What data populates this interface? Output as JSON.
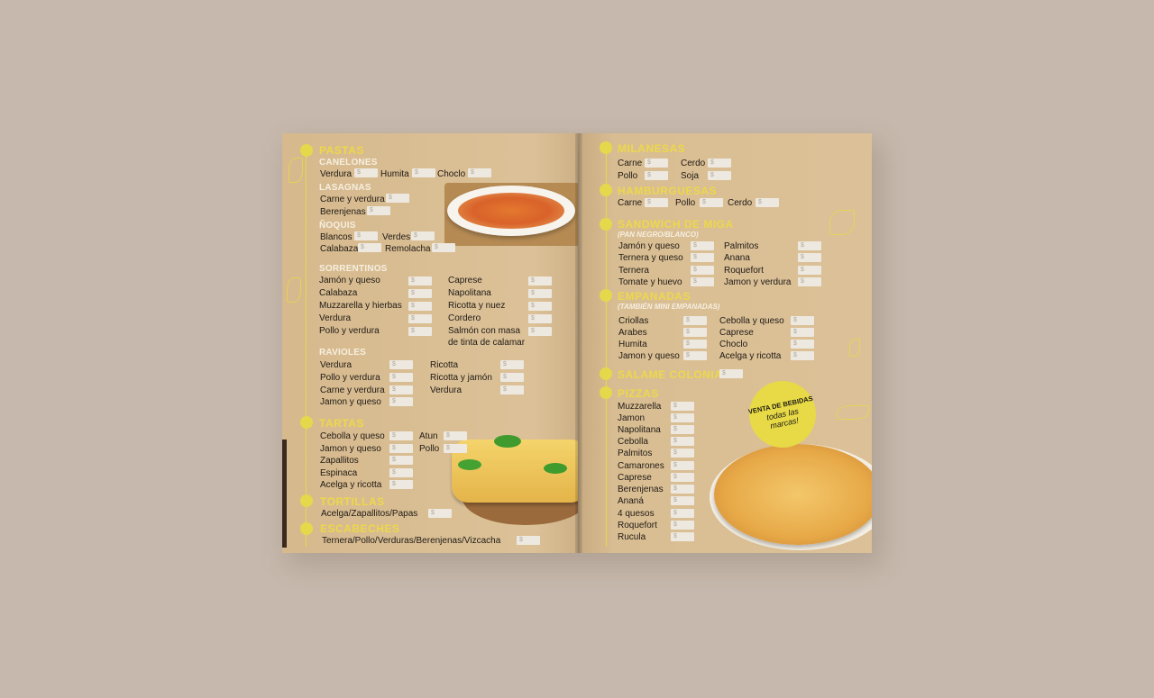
{
  "left_page": {
    "pastas": {
      "title": "PASTAS",
      "canelones": {
        "title": "CANELONES",
        "items": [
          "Verdura",
          "Humita",
          "Choclo"
        ]
      },
      "lasagnas": {
        "title": "LASAGNAS",
        "items": [
          "Carne y verdura",
          "Berenjenas"
        ]
      },
      "noquis": {
        "title": "ÑOQUIS",
        "items": [
          "Blancos",
          "Verdes",
          "Calabaza",
          "Remolacha"
        ]
      },
      "sorrentinos": {
        "title": "SORRENTINOS",
        "col1": [
          "Jamón y queso",
          "Calabaza",
          "Muzzarella y hierbas",
          "Verdura",
          "Pollo y verdura"
        ],
        "col2": [
          "Caprese",
          "Napolitana",
          "Ricotta y nuez",
          "Cordero",
          "Salmón con masa",
          "de tinta de calamar"
        ]
      },
      "ravioles": {
        "title": "RAVIOLES",
        "col1": [
          "Verdura",
          "Pollo y verdura",
          "Carne y verdura",
          "Jamon y queso"
        ],
        "col2": [
          "Ricotta",
          "Ricotta y jamón",
          "Verdura"
        ]
      }
    },
    "tartas": {
      "title": "TARTAS",
      "col1": [
        "Cebolla y queso",
        "Jamon y queso",
        "Zapallitos",
        "Espinaca",
        "Acelga y ricotta"
      ],
      "col2": [
        "Atun",
        "Pollo"
      ]
    },
    "tortillas": {
      "title": "TORTILLAS",
      "items": [
        "Acelga/Zapallitos/Papas"
      ]
    },
    "escabeches": {
      "title": "ESCABECHES",
      "items": [
        "Ternera/Pollo/Verduras/Berenjenas/Vizcacha"
      ]
    }
  },
  "right_page": {
    "milanesas": {
      "title": "MILANESAS",
      "items": [
        "Carne",
        "Cerdo",
        "Pollo",
        "Soja"
      ]
    },
    "hamburguesas": {
      "title": "HAMBURGUESAS",
      "items": [
        "Carne",
        "Pollo",
        "Cerdo"
      ]
    },
    "sandwich": {
      "title": "SANDWICH DE MIGA",
      "note": "(PAN NEGRO/BLANCO)",
      "col1": [
        "Jamón y queso",
        "Ternera y queso",
        "Ternera",
        "Tomate y huevo"
      ],
      "col2": [
        "Palmitos",
        "Anana",
        "Roquefort",
        "Jamon y verdura"
      ]
    },
    "empanadas": {
      "title": "EMPANADAS",
      "note": "(TAMBIÉN MINI EMPANADAS)",
      "col1": [
        "Criollas",
        "Arabes",
        "Humita",
        "Jamon y queso"
      ],
      "col2": [
        "Cebolla y queso",
        "Caprese",
        "Choclo",
        "Acelga y ricotta"
      ]
    },
    "salame": {
      "title": "SALAME COLONIA"
    },
    "pizzas": {
      "title": "PIZZAS",
      "items": [
        "Muzzarella",
        "Jamon",
        "Napolitana",
        "Cebolla",
        "Palmitos",
        "Camarones",
        "Caprese",
        "Berenjenas",
        "Ananá",
        "4 quesos",
        "Roquefort",
        "Rucula"
      ]
    },
    "badge": {
      "line1": "VENTA DE BEBIDAS",
      "line2": "todas las",
      "line3": "marcas!"
    }
  },
  "price_symbol": "$",
  "colors": {
    "background": "#c6b8ac",
    "page": "#d9bd92",
    "accent": "#e6d84b",
    "text": "#1e1a16"
  }
}
